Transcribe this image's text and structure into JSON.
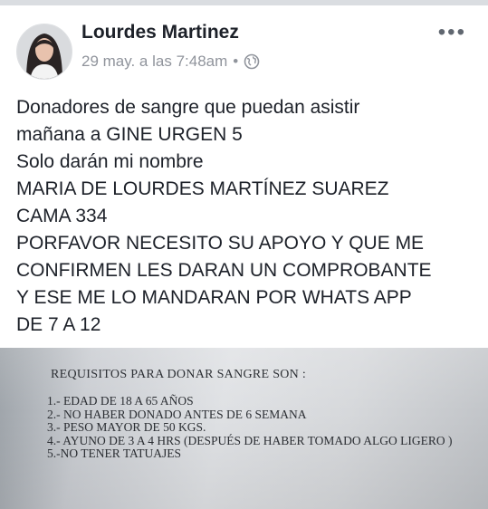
{
  "post": {
    "author": "Lourdes Martinez",
    "timestamp": "29 may. a las 7:48am",
    "separator": "•",
    "privacy_icon": "globe-icon",
    "more_icon": "more-options-icon",
    "more_label": "•••",
    "text_lines": [
      "Donadores de sangre que puedan asistir",
      "mañana a GINE URGEN 5",
      "Solo darán mi nombre",
      "MARIA DE LOURDES MARTÍNEZ SUAREZ",
      "CAMA 334",
      "PORFAVOR NECESITO SU APOYO Y QUE ME",
      "CONFIRMEN LES DARAN UN COMPROBANTE",
      "Y ESE ME LO MANDARAN POR WHATS APP",
      "DE 7 A 12"
    ]
  },
  "photo": {
    "title": "REQUISITOS PARA DONAR SANGRE SON :",
    "items": [
      "1.- EDAD DE 18 A 65 AÑOS",
      "2.- NO HABER DONADO ANTES DE 6 SEMANA",
      "3.- PESO MAYOR DE 50 KGS.",
      "4.- AYUNO DE 3 A 4 HRS (DESPUÉS DE HABER TOMADO ALGO LIGERO )",
      "5.-NO TENER TATUAJES"
    ]
  },
  "colors": {
    "name": "#1d2129",
    "meta": "#90949c",
    "divider": "#dadde1"
  }
}
